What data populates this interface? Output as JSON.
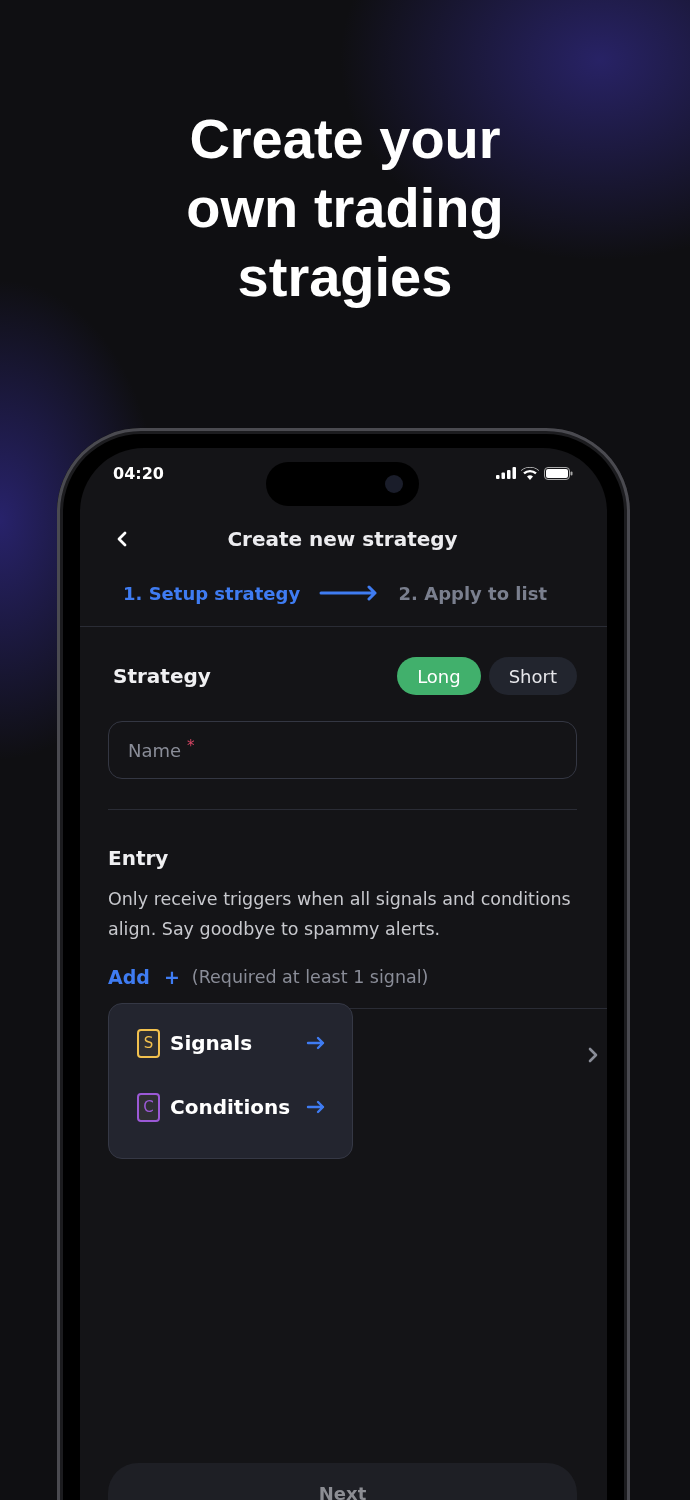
{
  "headline": [
    "Create your",
    "own trading",
    "stragies"
  ],
  "status_bar": {
    "time": "04:20"
  },
  "header": {
    "title": "Create new strategy"
  },
  "steps": [
    {
      "label": "1. Setup strategy",
      "selected": true
    },
    {
      "label": "2. Apply to list",
      "selected": false
    }
  ],
  "strategy": {
    "title": "Strategy",
    "options": [
      {
        "label": "Long",
        "selected": true
      },
      {
        "label": "Short",
        "selected": false
      }
    ]
  },
  "name_field": {
    "placeholder": "Name",
    "required_mark": "*"
  },
  "entry": {
    "title": "Entry",
    "description": "Only receive triggers when all signals and conditions align. Say goodbye to spammy alerts.",
    "add_label": "Add",
    "add_icon": "+",
    "hint": "(Required at least 1 signal)"
  },
  "menu": [
    {
      "badge": "S",
      "label": "Signals",
      "color": "#f2c14e"
    },
    {
      "badge": "C",
      "label": "Conditions",
      "color": "#9b59d6"
    }
  ],
  "next_button": {
    "label": "Next",
    "disabled": true
  }
}
